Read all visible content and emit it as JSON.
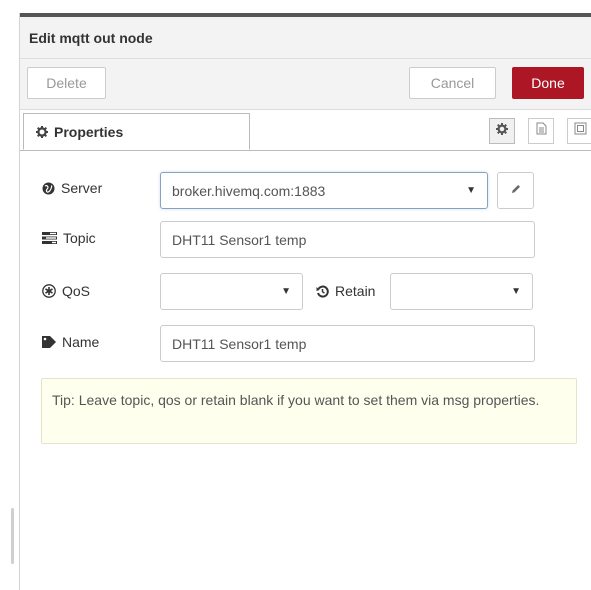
{
  "tray": {
    "title": "Edit mqtt out node"
  },
  "buttons": {
    "delete": "Delete",
    "cancel": "Cancel",
    "done": "Done"
  },
  "tabs": {
    "properties": "Properties"
  },
  "tab_icons": [
    "gear-icon",
    "document-icon",
    "layout-icon"
  ],
  "form": {
    "server": {
      "label": "Server",
      "value": "broker.hivemq.com:1883",
      "icon": "globe-icon"
    },
    "topic": {
      "label": "Topic",
      "value": "DHT11 Sensor1 temp",
      "icon": "tasks-icon"
    },
    "qos": {
      "label": "QoS",
      "value": "",
      "icon": "asterisk-circle-icon"
    },
    "retain": {
      "label": "Retain",
      "value": "",
      "icon": "history-icon"
    },
    "name": {
      "label": "Name",
      "value": "DHT11 Sensor1 temp",
      "icon": "tag-icon"
    }
  },
  "tip": "Tip: Leave topic, qos or retain blank if you want to set them via msg properties.",
  "colors": {
    "done_button": "#ad1625",
    "tip_background": "#ffffee",
    "header_background": "#f3f3f3"
  }
}
